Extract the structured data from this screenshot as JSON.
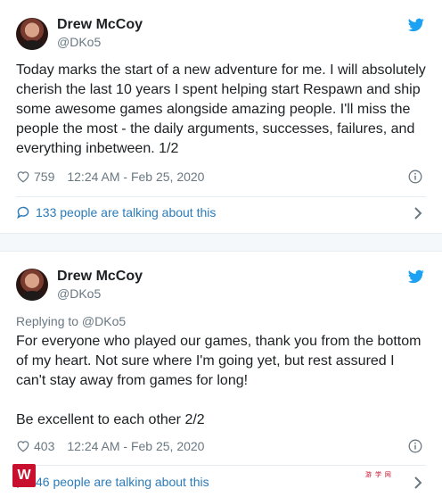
{
  "tweets": [
    {
      "name": "Drew McCoy",
      "handle": "@DKo5",
      "replying_to": "",
      "text": "Today marks the start of a new adventure for me. I will absolutely cherish the last 10 years I spent helping start Respawn and ship some awesome games alongside amazing people. I'll miss the people the most - the daily arguments, successes, failures, and everything inbetween. 1/2",
      "likes": "759",
      "timestamp": "12:24 AM - Feb 25, 2020",
      "talking": "133 people are talking about this"
    },
    {
      "name": "Drew McCoy",
      "handle": "@DKo5",
      "replying_to": "Replying to @DKo5",
      "text": "For everyone who played our games, thank you from the bottom of my heart. Not sure where I'm going yet, but rest assured I can't stay away from games for long!\n\nBe excellent to each other 2/2",
      "likes": "403",
      "timestamp": "12:24 AM - Feb 25, 2020",
      "talking": "46 people are talking about this"
    }
  ],
  "watermark": {
    "logo_text": "W",
    "mark_text": "游 学 网"
  },
  "colors": {
    "twitter_blue": "#1da1f2",
    "link_blue": "#2b7bb9",
    "gray": "#697882",
    "text": "#1c2022",
    "watermark_red": "#c8102e"
  },
  "icons": [
    "twitter-bird-icon",
    "heart-icon",
    "info-icon",
    "comment-icon",
    "chevron-right-icon"
  ]
}
